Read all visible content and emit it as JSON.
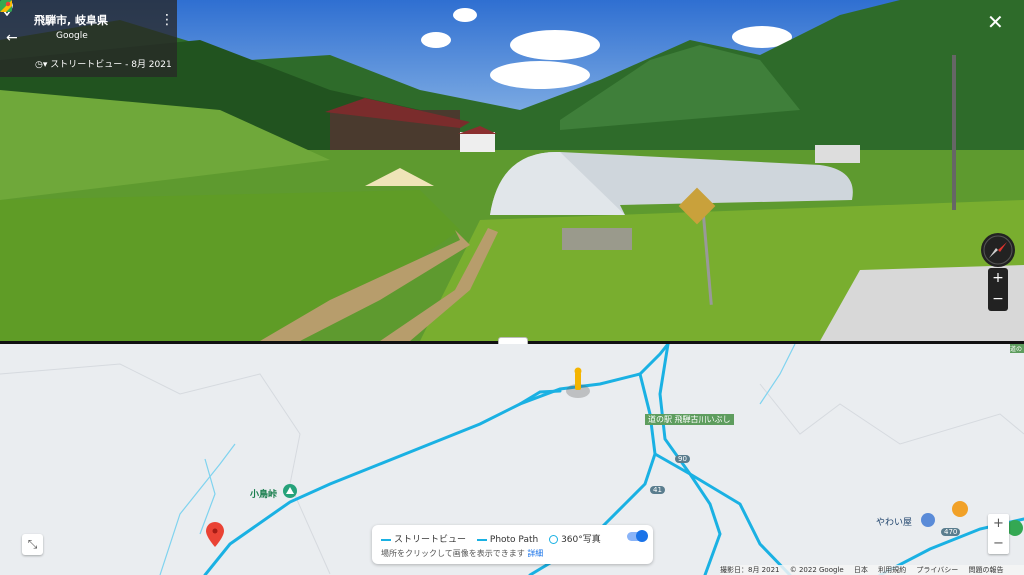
{
  "streetview": {
    "place": "飛騨市, 岐阜県",
    "provider": "Google",
    "streetview_label": "ストリートビュー - 8月 2021",
    "back_icon": "back-arrow-icon",
    "close_icon": "close-icon"
  },
  "map": {
    "labels": {
      "pass": "小鳥峠",
      "station": "道の駅 飛騨古川いぶし",
      "yawaiya": "やわい屋",
      "route_90": "90",
      "route_41": "41",
      "route_470": "470"
    },
    "legend": {
      "streetview": "ストリートビュー",
      "photo_path": "Photo Path",
      "photo360": "360°写真",
      "hint": "場所をクリックして画像を表示できます",
      "details_link": "詳細"
    },
    "footer": {
      "date": "撮影日：8月 2021",
      "copyright": "© 2022 Google",
      "country": "日本",
      "terms": "利用規約",
      "privacy": "プライバシー",
      "feedback": "問題の報告"
    },
    "colors": {
      "streetview_line": "#1ab1e3",
      "background": "#eaedf0"
    }
  }
}
